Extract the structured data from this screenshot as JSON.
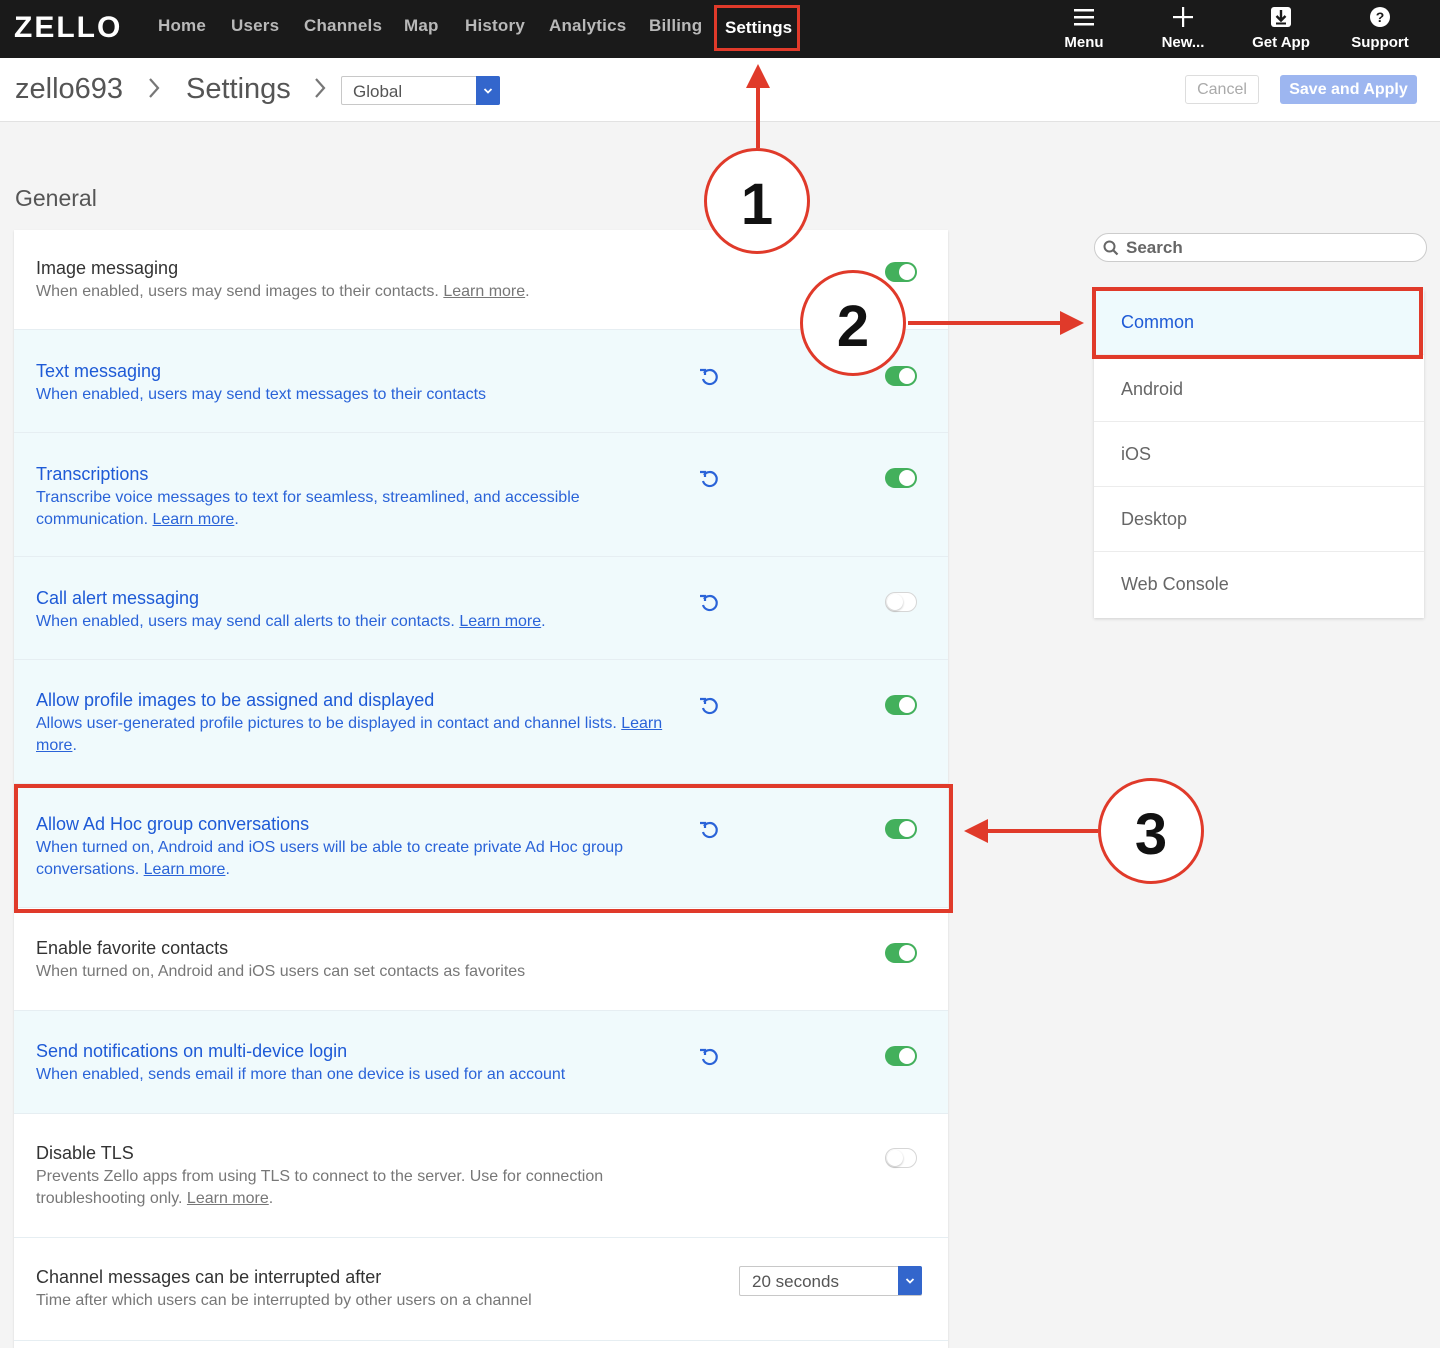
{
  "topbar": {
    "logo_text": "ZELLO",
    "nav": [
      "Home",
      "Users",
      "Channels",
      "Map",
      "History",
      "Analytics",
      "Billing",
      "Settings"
    ],
    "active_nav": "Settings",
    "tools": [
      {
        "label": "Menu",
        "icon": "hamburger-icon"
      },
      {
        "label": "New...",
        "icon": "plus-icon"
      },
      {
        "label": "Get App",
        "icon": "download-icon"
      },
      {
        "label": "Support",
        "icon": "help-icon"
      }
    ]
  },
  "header": {
    "breadcrumb": [
      "zello693",
      "Settings"
    ],
    "scope_select": "Global",
    "cancel_label": "Cancel",
    "save_label": "Save and Apply"
  },
  "section_title": "General",
  "settings": [
    {
      "title": "Image messaging",
      "desc": "When enabled, users may send images to their contacts.",
      "link": "Learn more",
      "modified": false,
      "enabled": true
    },
    {
      "title": "Text messaging",
      "desc": "When enabled, users may send text messages to their contacts",
      "link": "",
      "modified": true,
      "enabled": true
    },
    {
      "title": "Transcriptions",
      "desc": "Transcribe voice messages to text for seamless, streamlined, and accessible communication.",
      "link": "Learn more",
      "modified": true,
      "enabled": true
    },
    {
      "title": "Call alert messaging",
      "desc": "When enabled, users may send call alerts to their contacts.",
      "link": "Learn more",
      "modified": true,
      "enabled": false
    },
    {
      "title": "Allow profile images to be assigned and displayed",
      "desc": "Allows user-generated profile pictures to be displayed in contact and channel lists.",
      "link": "Learn more",
      "modified": true,
      "enabled": true
    },
    {
      "title": "Allow Ad Hoc group conversations",
      "desc": "When turned on, Android and iOS users will be able to create private Ad Hoc group conversations.",
      "link": "Learn more",
      "modified": true,
      "enabled": true
    },
    {
      "title": "Enable favorite contacts",
      "desc": "When turned on, Android and iOS users can set contacts as favorites",
      "link": "",
      "modified": false,
      "enabled": true
    },
    {
      "title": "Send notifications on multi-device login",
      "desc": "When enabled, sends email if more than one device is used for an account",
      "link": "",
      "modified": true,
      "enabled": true
    },
    {
      "title": "Disable TLS",
      "desc": "Prevents Zello apps from using TLS to connect to the server. Use for connection troubleshooting only.",
      "link": "Learn more",
      "modified": false,
      "enabled": false
    },
    {
      "title": "Channel messages can be interrupted after",
      "desc": "Time after which users can be interrupted by other users on a channel",
      "link": "",
      "modified": false,
      "select_value": "20 seconds"
    }
  ],
  "sidebar": {
    "search_placeholder": "Search",
    "categories": [
      "Common",
      "Android",
      "iOS",
      "Desktop",
      "Web Console"
    ],
    "active": "Common"
  },
  "annotations": [
    "1",
    "2",
    "3"
  ],
  "colors": {
    "highlight": "#e03a2a",
    "accent": "#1e5ad6",
    "toggle_on": "#43b05c",
    "topbar": "#1a1a1a"
  }
}
